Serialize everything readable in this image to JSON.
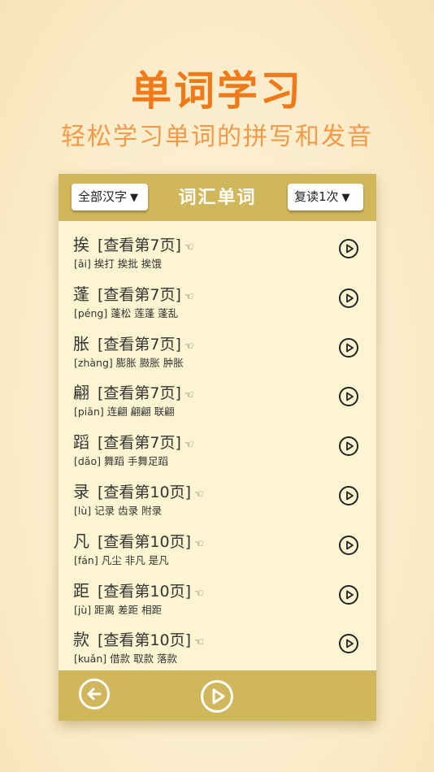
{
  "hero": {
    "title": "单词学习",
    "subtitle": "轻松学习单词的拼写和发音"
  },
  "header": {
    "filter_label": "全部汉字",
    "title": "词汇单词",
    "repeat_label": "复读1次",
    "caret": "▼"
  },
  "pointing_icon": "☜",
  "words": [
    {
      "char": "挨",
      "ref": "[查看第7页]",
      "pinyin": "[āi]",
      "examples": "挨打 挨批 挨饿"
    },
    {
      "char": "蓬",
      "ref": "[查看第7页]",
      "pinyin": "[péng]",
      "examples": "蓬松 莲蓬 蓬乱"
    },
    {
      "char": "胀",
      "ref": "[查看第7页]",
      "pinyin": "[zhàng]",
      "examples": "膨胀 臌胀 肿胀"
    },
    {
      "char": "翩",
      "ref": "[查看第7页]",
      "pinyin": "[piān]",
      "examples": "连翩 翩翩 联翩"
    },
    {
      "char": "蹈",
      "ref": "[查看第7页]",
      "pinyin": "[dǎo]",
      "examples": "舞蹈 手舞足蹈"
    },
    {
      "char": "录",
      "ref": "[查看第10页]",
      "pinyin": "[lù]",
      "examples": "记录 齿录 附录"
    },
    {
      "char": "凡",
      "ref": "[查看第10页]",
      "pinyin": "[fán]",
      "examples": "凡尘 非凡 是凡"
    },
    {
      "char": "距",
      "ref": "[查看第10页]",
      "pinyin": "[jù]",
      "examples": "距离 差距 相距"
    },
    {
      "char": "款",
      "ref": "[查看第10页]",
      "pinyin": "[kuǎn]",
      "examples": "借款 取款 落款"
    }
  ],
  "icons": {
    "play": "play-circle-icon",
    "back": "arrow-left-circle-icon",
    "pointing": "pointing-hand-icon"
  },
  "colors": {
    "accent_orange": "#f07a1a",
    "bar_gold": "#d1b75c",
    "panel_bg": "#fdf5d2"
  }
}
